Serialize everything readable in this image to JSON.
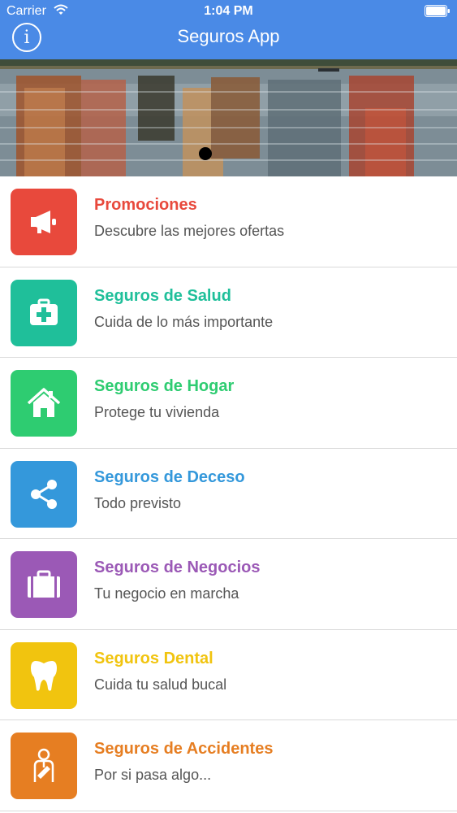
{
  "status_bar": {
    "carrier": "Carrier",
    "time": "1:04 PM"
  },
  "nav": {
    "info_label": "i",
    "title": "Seguros App"
  },
  "banner": {
    "page_count": 1,
    "current_page": 1
  },
  "items": [
    {
      "title": "Promociones",
      "subtitle": "Descubre las mejores ofertas",
      "color": "#e8493c",
      "icon": "megaphone-icon"
    },
    {
      "title": "Seguros de Salud",
      "subtitle": "Cuida de lo más importante",
      "color": "#1fbf9a",
      "icon": "medical-kit-icon"
    },
    {
      "title": "Seguros de Hogar",
      "subtitle": "Protege tu vivienda",
      "color": "#2ecc71",
      "icon": "house-icon"
    },
    {
      "title": "Seguros de Deceso",
      "subtitle": "Todo previsto",
      "color": "#3498db",
      "icon": "share-icon"
    },
    {
      "title": "Seguros de Negocios",
      "subtitle": "Tu negocio en marcha",
      "color": "#9b59b6",
      "icon": "briefcase-icon"
    },
    {
      "title": "Seguros Dental",
      "subtitle": "Cuida tu salud bucal",
      "color": "#f1c40f",
      "icon": "tooth-icon"
    },
    {
      "title": "Seguros de Accidentes",
      "subtitle": "Por si pasa algo...",
      "color": "#e67e22",
      "icon": "injured-person-icon"
    }
  ]
}
